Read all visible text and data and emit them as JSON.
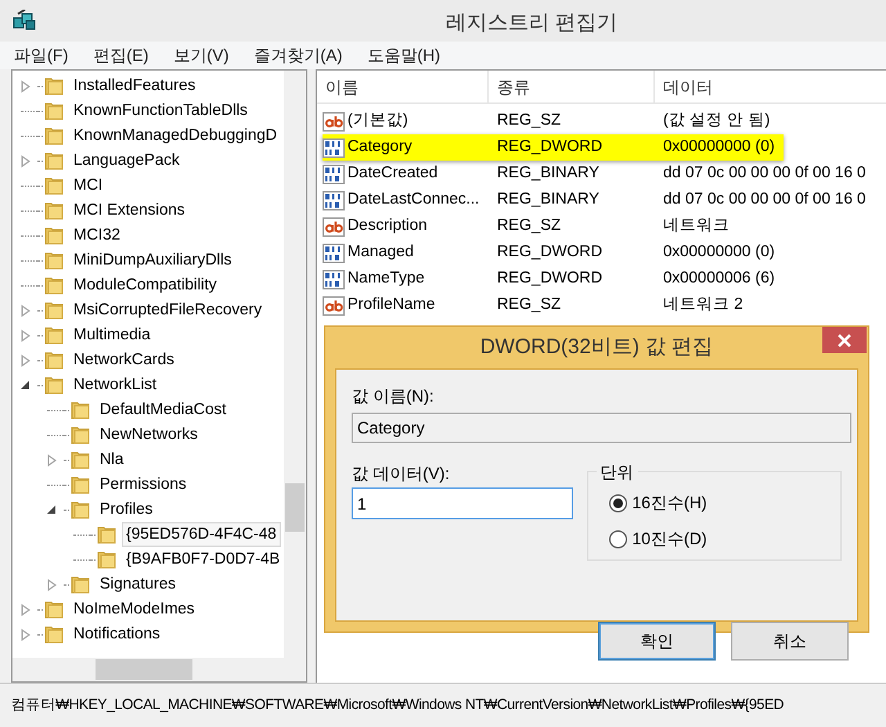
{
  "window": {
    "title": "레지스트리 편집기"
  },
  "menu": [
    "파일(F)",
    "편집(E)",
    "보기(V)",
    "즐겨찾기(A)",
    "도움말(H)"
  ],
  "tree": {
    "items": [
      {
        "label": "InstalledFeatures",
        "has_children": true,
        "expanded": false,
        "selected": false
      },
      {
        "label": "KnownFunctionTableDlls",
        "has_children": false,
        "expanded": false,
        "selected": false
      },
      {
        "label": "KnownManagedDebuggingD",
        "has_children": false,
        "expanded": false,
        "selected": false
      },
      {
        "label": "LanguagePack",
        "has_children": true,
        "expanded": false,
        "selected": false
      },
      {
        "label": "MCI",
        "has_children": false,
        "expanded": false,
        "selected": false
      },
      {
        "label": "MCI Extensions",
        "has_children": false,
        "expanded": false,
        "selected": false
      },
      {
        "label": "MCI32",
        "has_children": false,
        "expanded": false,
        "selected": false
      },
      {
        "label": "MiniDumpAuxiliaryDlls",
        "has_children": false,
        "expanded": false,
        "selected": false
      },
      {
        "label": "ModuleCompatibility",
        "has_children": false,
        "expanded": false,
        "selected": false
      },
      {
        "label": "MsiCorruptedFileRecovery",
        "has_children": true,
        "expanded": false,
        "selected": false
      },
      {
        "label": "Multimedia",
        "has_children": true,
        "expanded": false,
        "selected": false
      },
      {
        "label": "NetworkCards",
        "has_children": true,
        "expanded": false,
        "selected": false
      },
      {
        "label": "NetworkList",
        "has_children": true,
        "expanded": true,
        "selected": false,
        "children": [
          {
            "label": "DefaultMediaCost",
            "has_children": false,
            "expanded": false,
            "selected": false
          },
          {
            "label": "NewNetworks",
            "has_children": false,
            "expanded": false,
            "selected": false
          },
          {
            "label": "Nla",
            "has_children": true,
            "expanded": false,
            "selected": false
          },
          {
            "label": "Permissions",
            "has_children": false,
            "expanded": false,
            "selected": false
          },
          {
            "label": "Profiles",
            "has_children": true,
            "expanded": true,
            "selected": false,
            "children": [
              {
                "label": "{95ED576D-4F4C-48",
                "has_children": false,
                "expanded": false,
                "selected": true
              },
              {
                "label": "{B9AFB0F7-D0D7-4B",
                "has_children": false,
                "expanded": false,
                "selected": false
              }
            ]
          },
          {
            "label": "Signatures",
            "has_children": true,
            "expanded": false,
            "selected": false
          }
        ]
      },
      {
        "label": "NoImeModeImes",
        "has_children": true,
        "expanded": false,
        "selected": false
      },
      {
        "label": "Notifications",
        "has_children": true,
        "expanded": false,
        "selected": false
      }
    ]
  },
  "values": {
    "columns": [
      "이름",
      "종류",
      "데이터"
    ],
    "rows": [
      {
        "kind": "string",
        "name": "(기본값)",
        "type": "REG_SZ",
        "data": "(값 설정 안 됨)",
        "highlighted": false
      },
      {
        "kind": "binary",
        "name": "Category",
        "type": "REG_DWORD",
        "data": "0x00000000 (0)",
        "highlighted": true
      },
      {
        "kind": "binary",
        "name": "DateCreated",
        "type": "REG_BINARY",
        "data": "dd 07 0c 00 00 00 0f 00 16 0",
        "highlighted": false
      },
      {
        "kind": "binary",
        "name": "DateLastConnec...",
        "type": "REG_BINARY",
        "data": "dd 07 0c 00 00 00 0f 00 16 0",
        "highlighted": false
      },
      {
        "kind": "string",
        "name": "Description",
        "type": "REG_SZ",
        "data": "네트워크",
        "highlighted": false
      },
      {
        "kind": "binary",
        "name": "Managed",
        "type": "REG_DWORD",
        "data": "0x00000000 (0)",
        "highlighted": false
      },
      {
        "kind": "binary",
        "name": "NameType",
        "type": "REG_DWORD",
        "data": "0x00000006 (6)",
        "highlighted": false
      },
      {
        "kind": "string",
        "name": "ProfileName",
        "type": "REG_SZ",
        "data": "네트워크  2",
        "highlighted": false
      }
    ]
  },
  "dialog": {
    "title": "DWORD(32비트) 값 편집",
    "name_label": "값 이름(N):",
    "name_value": "Category",
    "data_label": "값 데이터(V):",
    "data_value": "1",
    "base_group": "단위",
    "bases": [
      {
        "label": "16진수(H)",
        "selected": true
      },
      {
        "label": "10진수(D)",
        "selected": false
      }
    ],
    "buttons": [
      {
        "label": "확인",
        "default": true
      },
      {
        "label": "취소",
        "default": false
      }
    ]
  },
  "status_bar": "컴퓨터₩HKEY_LOCAL_MACHINE₩SOFTWARE₩Microsoft₩Windows NT₩CurrentVersion₩NetworkList₩Profiles₩{95ED"
}
